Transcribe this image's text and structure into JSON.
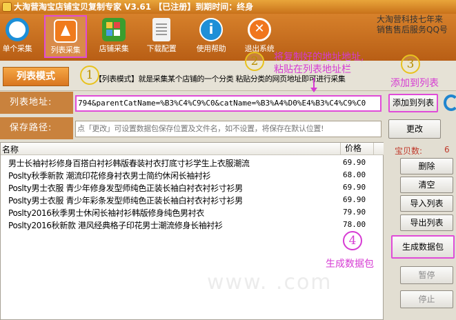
{
  "window": {
    "title": "大淘营淘宝店铺宝贝复制专家 V3.61 【已注册】到期时间：终身"
  },
  "toolbar": {
    "buttons": [
      {
        "label": "单个采集",
        "icon": "magnifier-icon"
      },
      {
        "label": "列表采集",
        "icon": "list-collect-icon"
      },
      {
        "label": "店铺采集",
        "icon": "store-icon"
      },
      {
        "label": "下载配置",
        "icon": "document-icon"
      },
      {
        "label": "使用帮助",
        "icon": "info-icon"
      },
      {
        "label": "退出系统",
        "icon": "exit-icon"
      }
    ],
    "promo_line1": "大淘营科技七年来",
    "promo_line2": "销售售后服务QQ号"
  },
  "mode": {
    "tab": "列表模式",
    "description": "【列表模式】就是采集某个店铺的一个分类  粘贴分类的网页地址即可进行采集"
  },
  "url_row": {
    "label": "列表地址:",
    "value": "794&parentCatName=%B3%C4%C9%C0&catName=%B3%A4%D0%E4%B3%C4%C9%C0",
    "add_button": "添加到列表"
  },
  "path_row": {
    "label": "保存路径:",
    "placeholder": "点「更改」可设置数据包保存位置及文件名，如不设置，将保存在默认位置!",
    "change_button": "更改"
  },
  "list": {
    "col_name": "名称",
    "col_price": "价格",
    "rows": [
      {
        "name": "男士长袖衬衫修身百搭白衬衫韩版春装衬衣打底寸衫学生上衣服潮流",
        "price": "69.90"
      },
      {
        "name": "Poslty秋季新款 潮流印花修身衬衣男士简约休闲长袖衬衫",
        "price": "68.00"
      },
      {
        "name": "Poslty男士衣服 青少年修身发型师纯色正装长袖白衬衣衬衫寸衫男",
        "price": "69.90"
      },
      {
        "name": "Poslty男士衣服 青少年彩条发型师纯色正装长袖白衬衣衬衫寸衫男",
        "price": "69.90"
      },
      {
        "name": "Poslty2016秋季男士休闲长袖衬衫韩版修身纯色男衬衣",
        "price": "79.90"
      },
      {
        "name": "Poslty2016秋新款 港风经典格子印花男士潮流修身长袖衬衫",
        "price": "78.00"
      }
    ]
  },
  "side": {
    "count_label": "宝贝数:",
    "count_value": "6",
    "delete": "删除",
    "clear": "清空",
    "import": "导入列表",
    "export": "导出列表",
    "generate": "生成数据包",
    "pause": "暂停",
    "stop": "停止"
  },
  "annotations": {
    "step1": "1",
    "step2": "2",
    "step3": "3",
    "step4": "4",
    "note2_line1": "将复制好的地址地址,",
    "note2_line2": "粘贴在列表地址栏",
    "note3": "添加到列表",
    "note4": "生成数据包"
  },
  "colors": {
    "accent": "#d98b4a",
    "annotation": "#d63bd3",
    "count": "#c0392b"
  }
}
